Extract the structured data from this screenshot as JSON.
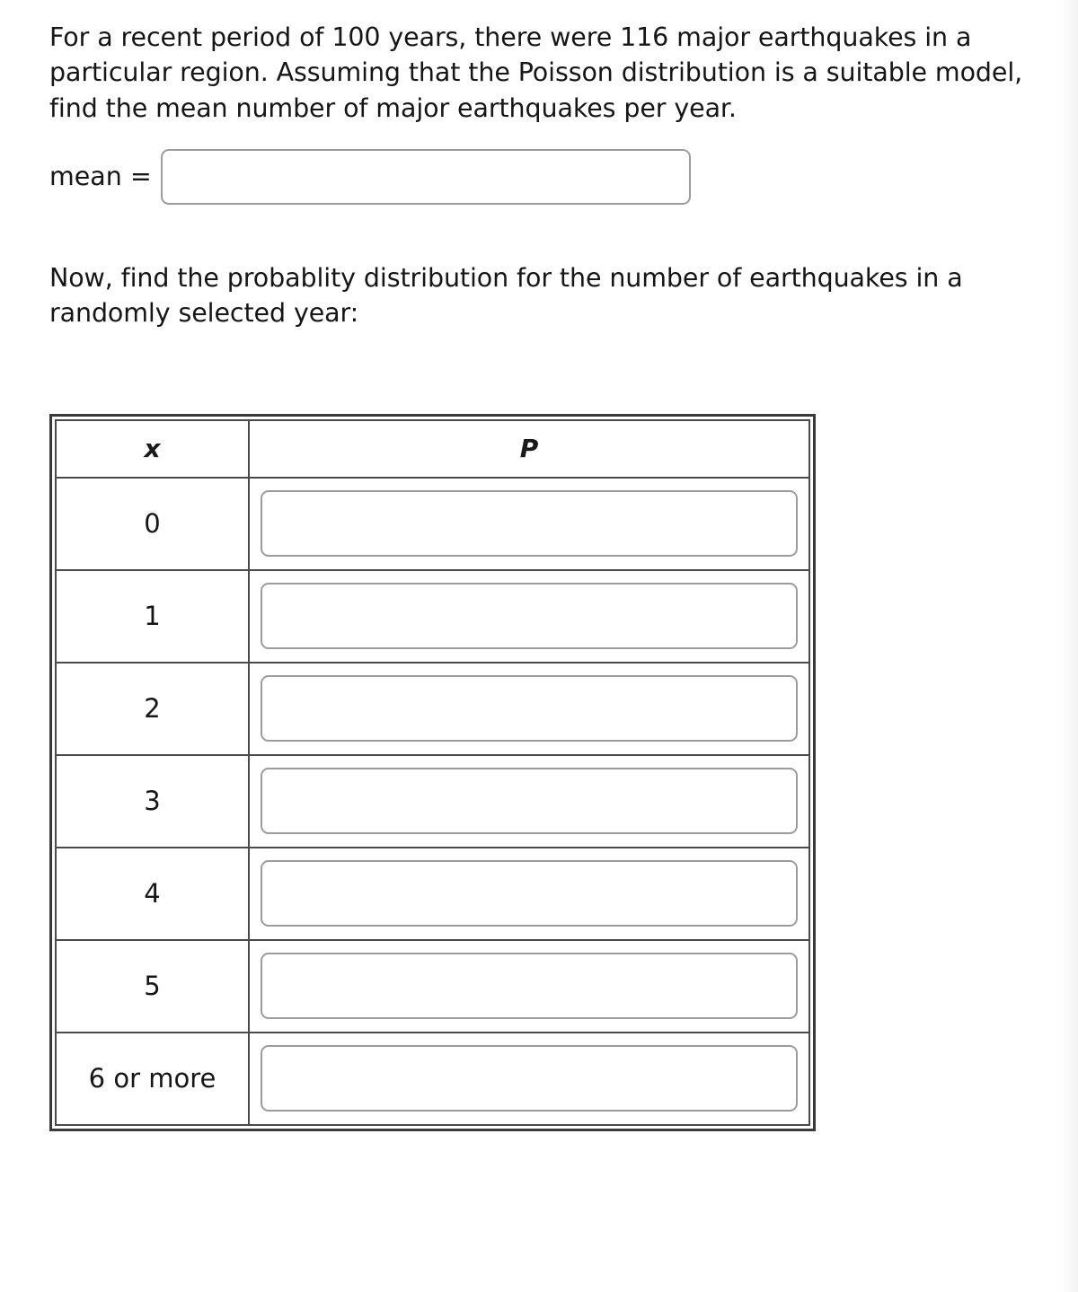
{
  "question": {
    "paragraph1": "For a recent period of 100 years, there were 116 major earthquakes in a particular region. Assuming that the Poisson distribution is a suitable model, find the mean number of major earthquakes per year.",
    "mean_label": "mean =",
    "mean_value": "",
    "mean_placeholder": "",
    "paragraph2": "Now, find the probablity distribution for the number of earthquakes in a randomly selected year:"
  },
  "table": {
    "headers": {
      "x": "x",
      "p": "P"
    },
    "rows": [
      {
        "x": "0",
        "p": "",
        "placeholder": ""
      },
      {
        "x": "1",
        "p": "",
        "placeholder": ""
      },
      {
        "x": "2",
        "p": "",
        "placeholder": ""
      },
      {
        "x": "3",
        "p": "",
        "placeholder": ""
      },
      {
        "x": "4",
        "p": "",
        "placeholder": ""
      },
      {
        "x": "5",
        "p": "",
        "placeholder": ""
      },
      {
        "x": "6 or more",
        "p": "",
        "placeholder": ""
      }
    ]
  }
}
